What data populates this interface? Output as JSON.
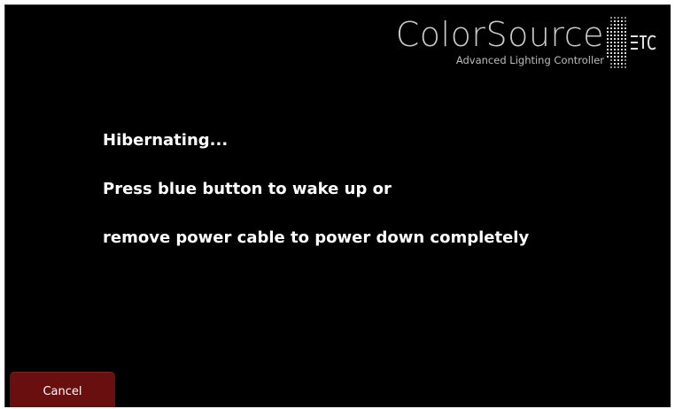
{
  "brand": {
    "name": "ColorSource",
    "tagline": "Advanced Lighting Controller",
    "logo_text": "ETC"
  },
  "message": {
    "status": "Hibernating...",
    "instruction_1": "Press blue button to wake up or",
    "instruction_2": "remove power cable to power down completely"
  },
  "actions": {
    "cancel_label": "Cancel"
  },
  "colors": {
    "background": "#000000",
    "text": "#ffffff",
    "cancel_button": "#6a0f0f",
    "brand_text": "#c9c9c9"
  }
}
